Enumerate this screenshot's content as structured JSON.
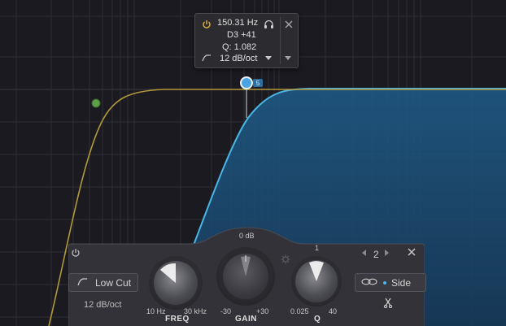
{
  "tooltip": {
    "frequency": "150.31 Hz",
    "note": "D3 +41",
    "q": "Q: 1.082",
    "slope": "12 dB/oct"
  },
  "band": {
    "number_badge": "5",
    "index": "2"
  },
  "panel": {
    "filter_type": "Low Cut",
    "slope": "12 dB/oct",
    "gain_top": "0 dB",
    "freq": {
      "label": "FREQ",
      "min": "10 Hz",
      "max": "30 kHz"
    },
    "gain": {
      "label": "GAIN",
      "min": "-30",
      "max": "+30"
    },
    "q": {
      "label": "Q",
      "min": "0.025",
      "max": "40",
      "mid": "1"
    },
    "stereo": "Side"
  },
  "colors": {
    "background": "#1b1a20",
    "grid": "#2e2d35",
    "blue_curve": "#4ab6e6",
    "blue_fill": "#1d4d73",
    "yellow_curve": "#b29a3a",
    "green_node": "#5fa04a",
    "power_icon": "#e0b43a"
  },
  "icons": [
    "power-icon",
    "headphones-icon",
    "close-icon",
    "chevron-down-icon",
    "lowcut-shape-icon",
    "chevron-left-icon",
    "chevron-right-icon",
    "link-icon",
    "scissors-icon",
    "gear-icon"
  ]
}
